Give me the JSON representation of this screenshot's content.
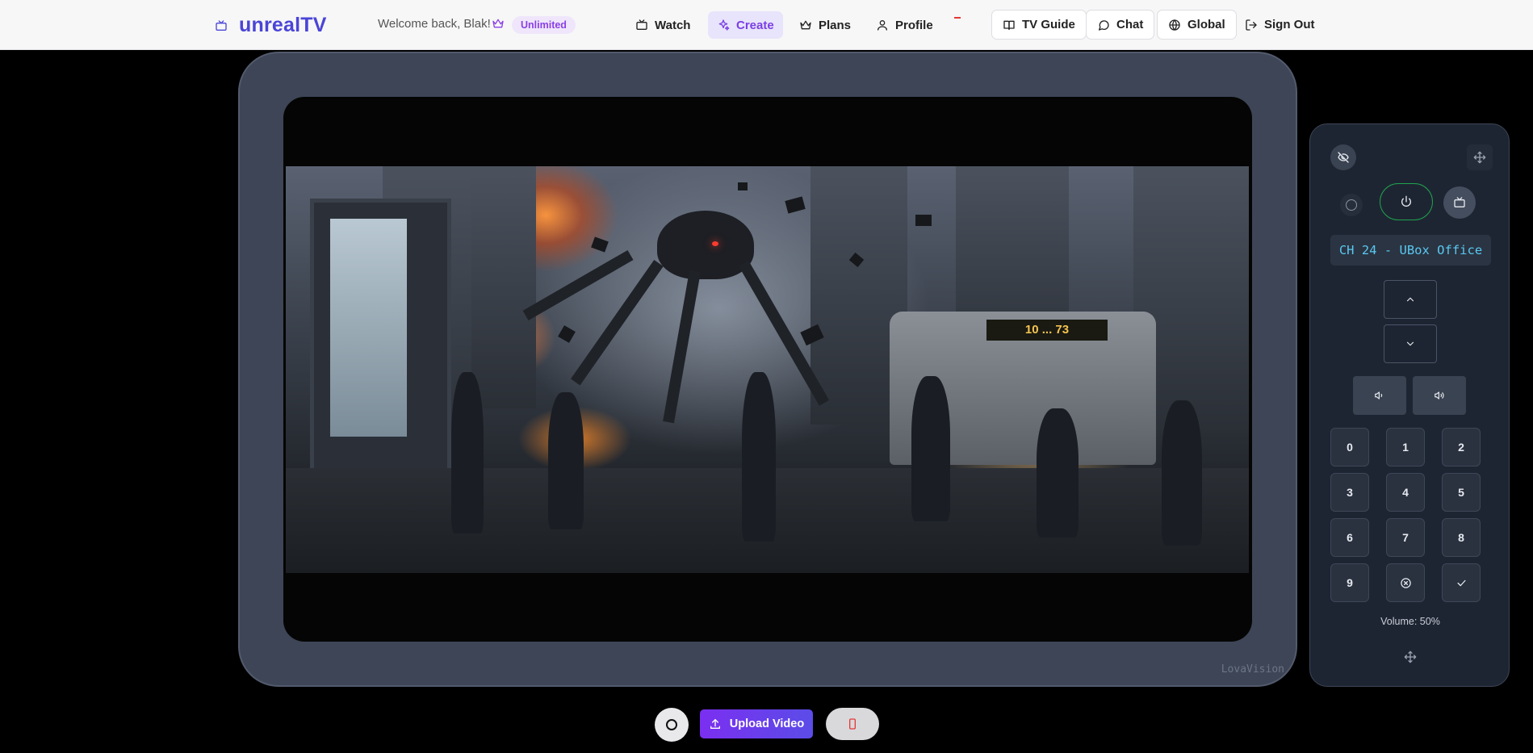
{
  "header": {
    "logo_text": "unrealTV",
    "welcome_text": "Welcome back, Blak!",
    "plan_badge": "Unlimited",
    "nav": [
      {
        "label": "Watch",
        "icon": "tv-icon"
      },
      {
        "label": "Create",
        "icon": "sparkles-icon",
        "active": true
      },
      {
        "label": "Plans",
        "icon": "crown-icon"
      },
      {
        "label": "Profile",
        "icon": "user-icon"
      }
    ],
    "actions": [
      {
        "label": "TV Guide",
        "icon": "book-icon"
      },
      {
        "label": "Chat",
        "icon": "chat-icon"
      },
      {
        "label": "Global",
        "icon": "globe-icon"
      },
      {
        "label": "Sign Out",
        "icon": "logout-icon"
      }
    ]
  },
  "tv": {
    "brand": "LovaVision",
    "bus_sign": "10 ... 73"
  },
  "remote": {
    "channel_display": "CH 24 - UBox Office",
    "keys": [
      "0",
      "1",
      "2",
      "3",
      "4",
      "5",
      "6",
      "7",
      "8",
      "9"
    ],
    "volume_text": "Volume: 50%",
    "volume_level": 0.5
  },
  "bottom": {
    "upload_label": "Upload Video"
  },
  "colors": {
    "brand": "#4a45d6",
    "accent": "#7b3fe4",
    "power_ring": "#1ea34f",
    "channel_text": "#59c8f2"
  }
}
